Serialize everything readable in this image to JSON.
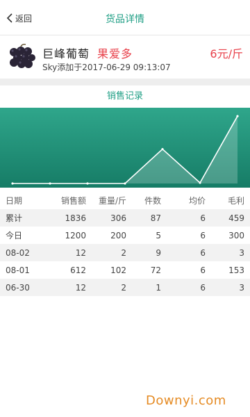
{
  "nav": {
    "back_label": "返回",
    "title": "货品详情"
  },
  "product": {
    "name": "巨峰葡萄",
    "shop": "果爱多",
    "price": "6元/斤",
    "added_text": "Sky添加于2017-06-29 09:13:07",
    "image_icon": "grapes-icon"
  },
  "sales": {
    "section_title": "销售记录",
    "chart_data": {
      "type": "area",
      "title": "",
      "xlabel": "",
      "ylabel": "",
      "x": [
        1,
        2,
        3,
        4,
        5,
        6,
        7
      ],
      "values": [
        0,
        0,
        0,
        0,
        612,
        12,
        1200
      ],
      "ylim": [
        0,
        1300
      ],
      "grid": false,
      "legend": "none"
    },
    "columns": [
      "日期",
      "销售额",
      "重量/斤",
      "件数",
      "均价",
      "毛利"
    ],
    "rows": [
      [
        "累计",
        "1836",
        "306",
        "87",
        "6",
        "459"
      ],
      [
        "今日",
        "1200",
        "200",
        "5",
        "6",
        "300"
      ],
      [
        "08-02",
        "12",
        "2",
        "9",
        "6",
        "3"
      ],
      [
        "08-01",
        "612",
        "102",
        "72",
        "6",
        "153"
      ],
      [
        "06-30",
        "12",
        "2",
        "1",
        "6",
        "3"
      ]
    ]
  },
  "watermark": {
    "text": "Downyi",
    "suffix": ".com"
  },
  "colors": {
    "accent": "#1e9e84",
    "price": "#e8404a",
    "chart_top": "#2fa68b",
    "chart_bottom": "#177e68"
  }
}
